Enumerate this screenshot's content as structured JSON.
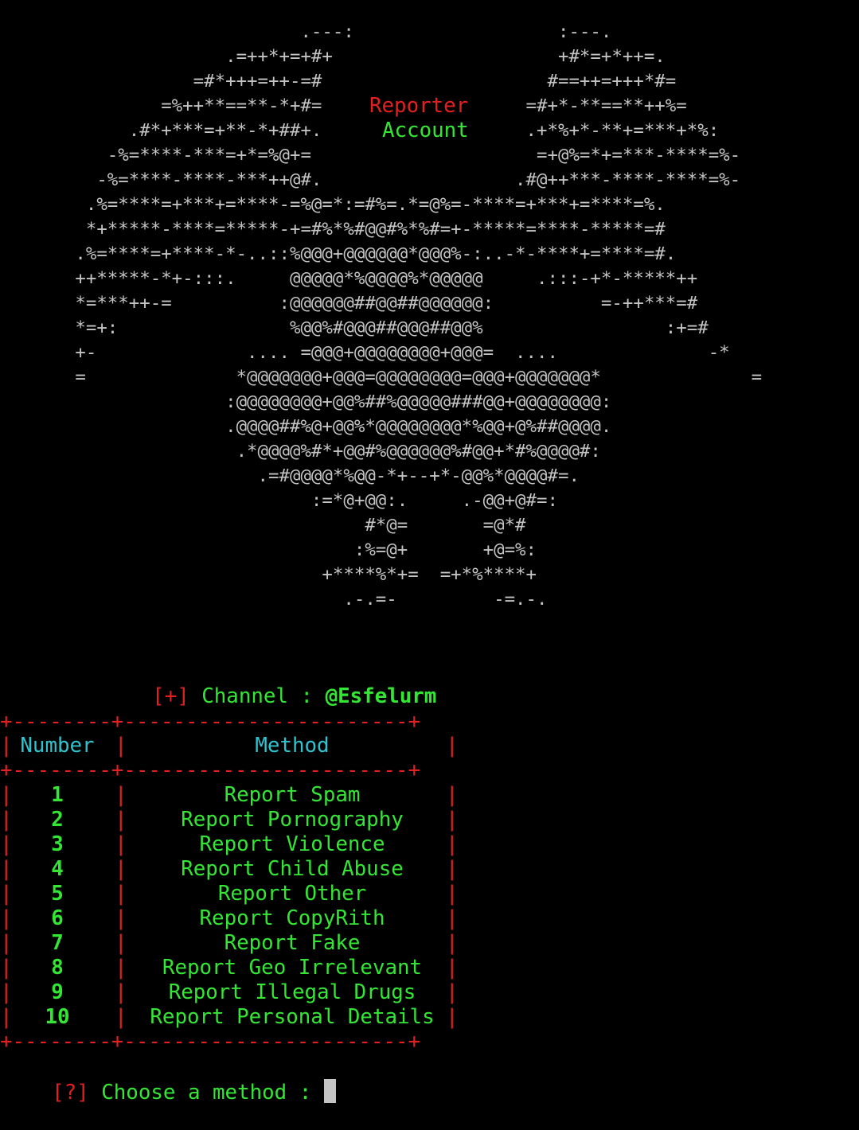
{
  "colors": {
    "background": "#000000",
    "ascii_art": "#c4c4c4",
    "red": "#e51f1f",
    "green": "#34e634",
    "cyan": "#2ec4cf",
    "cursor": "#c4c4c4"
  },
  "banner": {
    "ascii_lines": [
      "                            .---:                   :---.",
      "                     .=++*+=+#+                     +#*=+*++=.",
      "                  =#*+++=++-=#                     #==++=+++*#=",
      "               =%++**==**-*+#=                   =#+*-**==**++%=",
      "            .#*+***=+**-*+##+.                   .+*%+*-**+=***+*%:",
      "          -%=****-***=+*=%@+=                     =+@%=*+=***-****=%-",
      "         -%=****-****-***++@#.                  .#@++***-****-****=%-",
      "        .%=****=+***+=****-=%@=*:=#%=.*=@%=-****=+***+=****=%.",
      "        *+*****-****=*****-+=#%*%#@@#%*%#=+-*****=****-*****=#",
      "       .%=****=+****-*-..::%@@@+@@@@@@*@@@%-:..-*-****+=****=#.",
      "       ++*****-*+-:::.     @@@@@*%@@@@%*@@@@@     .:::-+*-*****++",
      "       *=***++-=          :@@@@@@##@@##@@@@@@:          =-++***=#",
      "       *=+:                %@@%#@@@##@@@##@@%                 :+=#",
      "       +-              .... =@@@+@@@@@@@@+@@@=  ....              -*",
      "       =              *@@@@@@@+@@@=@@@@@@@@=@@@+@@@@@@@*              =",
      "                     :@@@@@@@@+@@%##%@@@@@###@@+@@@@@@@@:",
      "                     .@@@@##%@+@@%*@@@@@@@@*%@@+@%##@@@@.",
      "                      .*@@@@%#*+@@#%@@@@@@%#@@+*#%@@@@#:",
      "                        .=#@@@@*%@@-*+--+*-@@%*@@@@#=.",
      "                             :=*@+@@:.     .-@@+@#=:",
      "                                  #*@=       =@*#",
      "                                 :%=@+       +@=%:",
      "                              +****%*+=  =+*%****+",
      "                                .-.=-         -=.-."
    ],
    "title_line1": "Reporter",
    "title_line2": "Account"
  },
  "channel": {
    "bracket_open": "[",
    "marker": "+",
    "bracket_close": "]",
    "label": "Channel : ",
    "handle": "@Esfelurm"
  },
  "table": {
    "border_top": "+--------+-----------------------+",
    "border_mid": "+--------+-----------------------+",
    "border_bottom": "+--------+-----------------------+",
    "headers": {
      "number": "Number",
      "method": "Method"
    },
    "rows": [
      {
        "number": "1",
        "method": "Report Spam"
      },
      {
        "number": "2",
        "method": "Report Pornography"
      },
      {
        "number": "3",
        "method": "Report Violence"
      },
      {
        "number": "4",
        "method": "Report Child Abuse"
      },
      {
        "number": "5",
        "method": "Report Other"
      },
      {
        "number": "6",
        "method": "Report CopyRith"
      },
      {
        "number": "7",
        "method": "Report Fake"
      },
      {
        "number": "8",
        "method": "Report Geo Irrelevant"
      },
      {
        "number": "9",
        "method": "Report Illegal Drugs"
      },
      {
        "number": "10",
        "method": "Report Personal Details"
      }
    ]
  },
  "prompt": {
    "marker": "[?]",
    "text": "Choose a method : "
  }
}
